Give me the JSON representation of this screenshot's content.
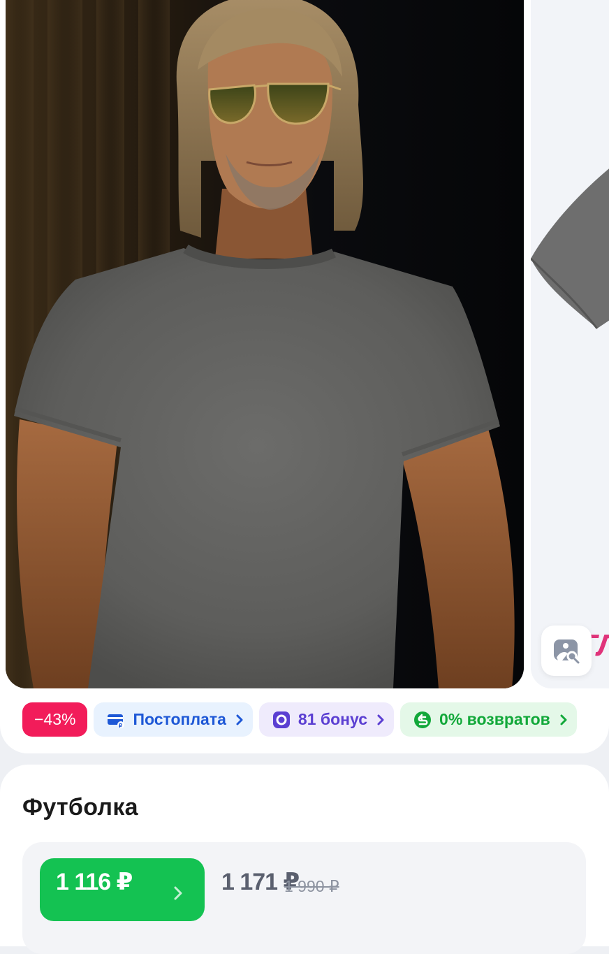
{
  "gallery": {
    "image_search_icon": "image-search-icon",
    "next_photo_partial_text": "ТЛ"
  },
  "badges": {
    "discount": "−43%",
    "postpay": {
      "label": "Постоплата",
      "icon": "card-icon",
      "color": "#1e58d6"
    },
    "bonus": {
      "label": "81 бонус",
      "icon": "bonus-coin-icon",
      "color": "#5b3fd2"
    },
    "returns": {
      "label": "0% возвратов",
      "icon": "return-icon",
      "color": "#12a83a"
    }
  },
  "product": {
    "title": "Футболка"
  },
  "prices": {
    "main": "1 116 ₽",
    "regular": "1 171 ₽",
    "old": "1 990 ₽"
  },
  "colors": {
    "discount": "#f21c5a",
    "accent_green": "#14c252"
  }
}
